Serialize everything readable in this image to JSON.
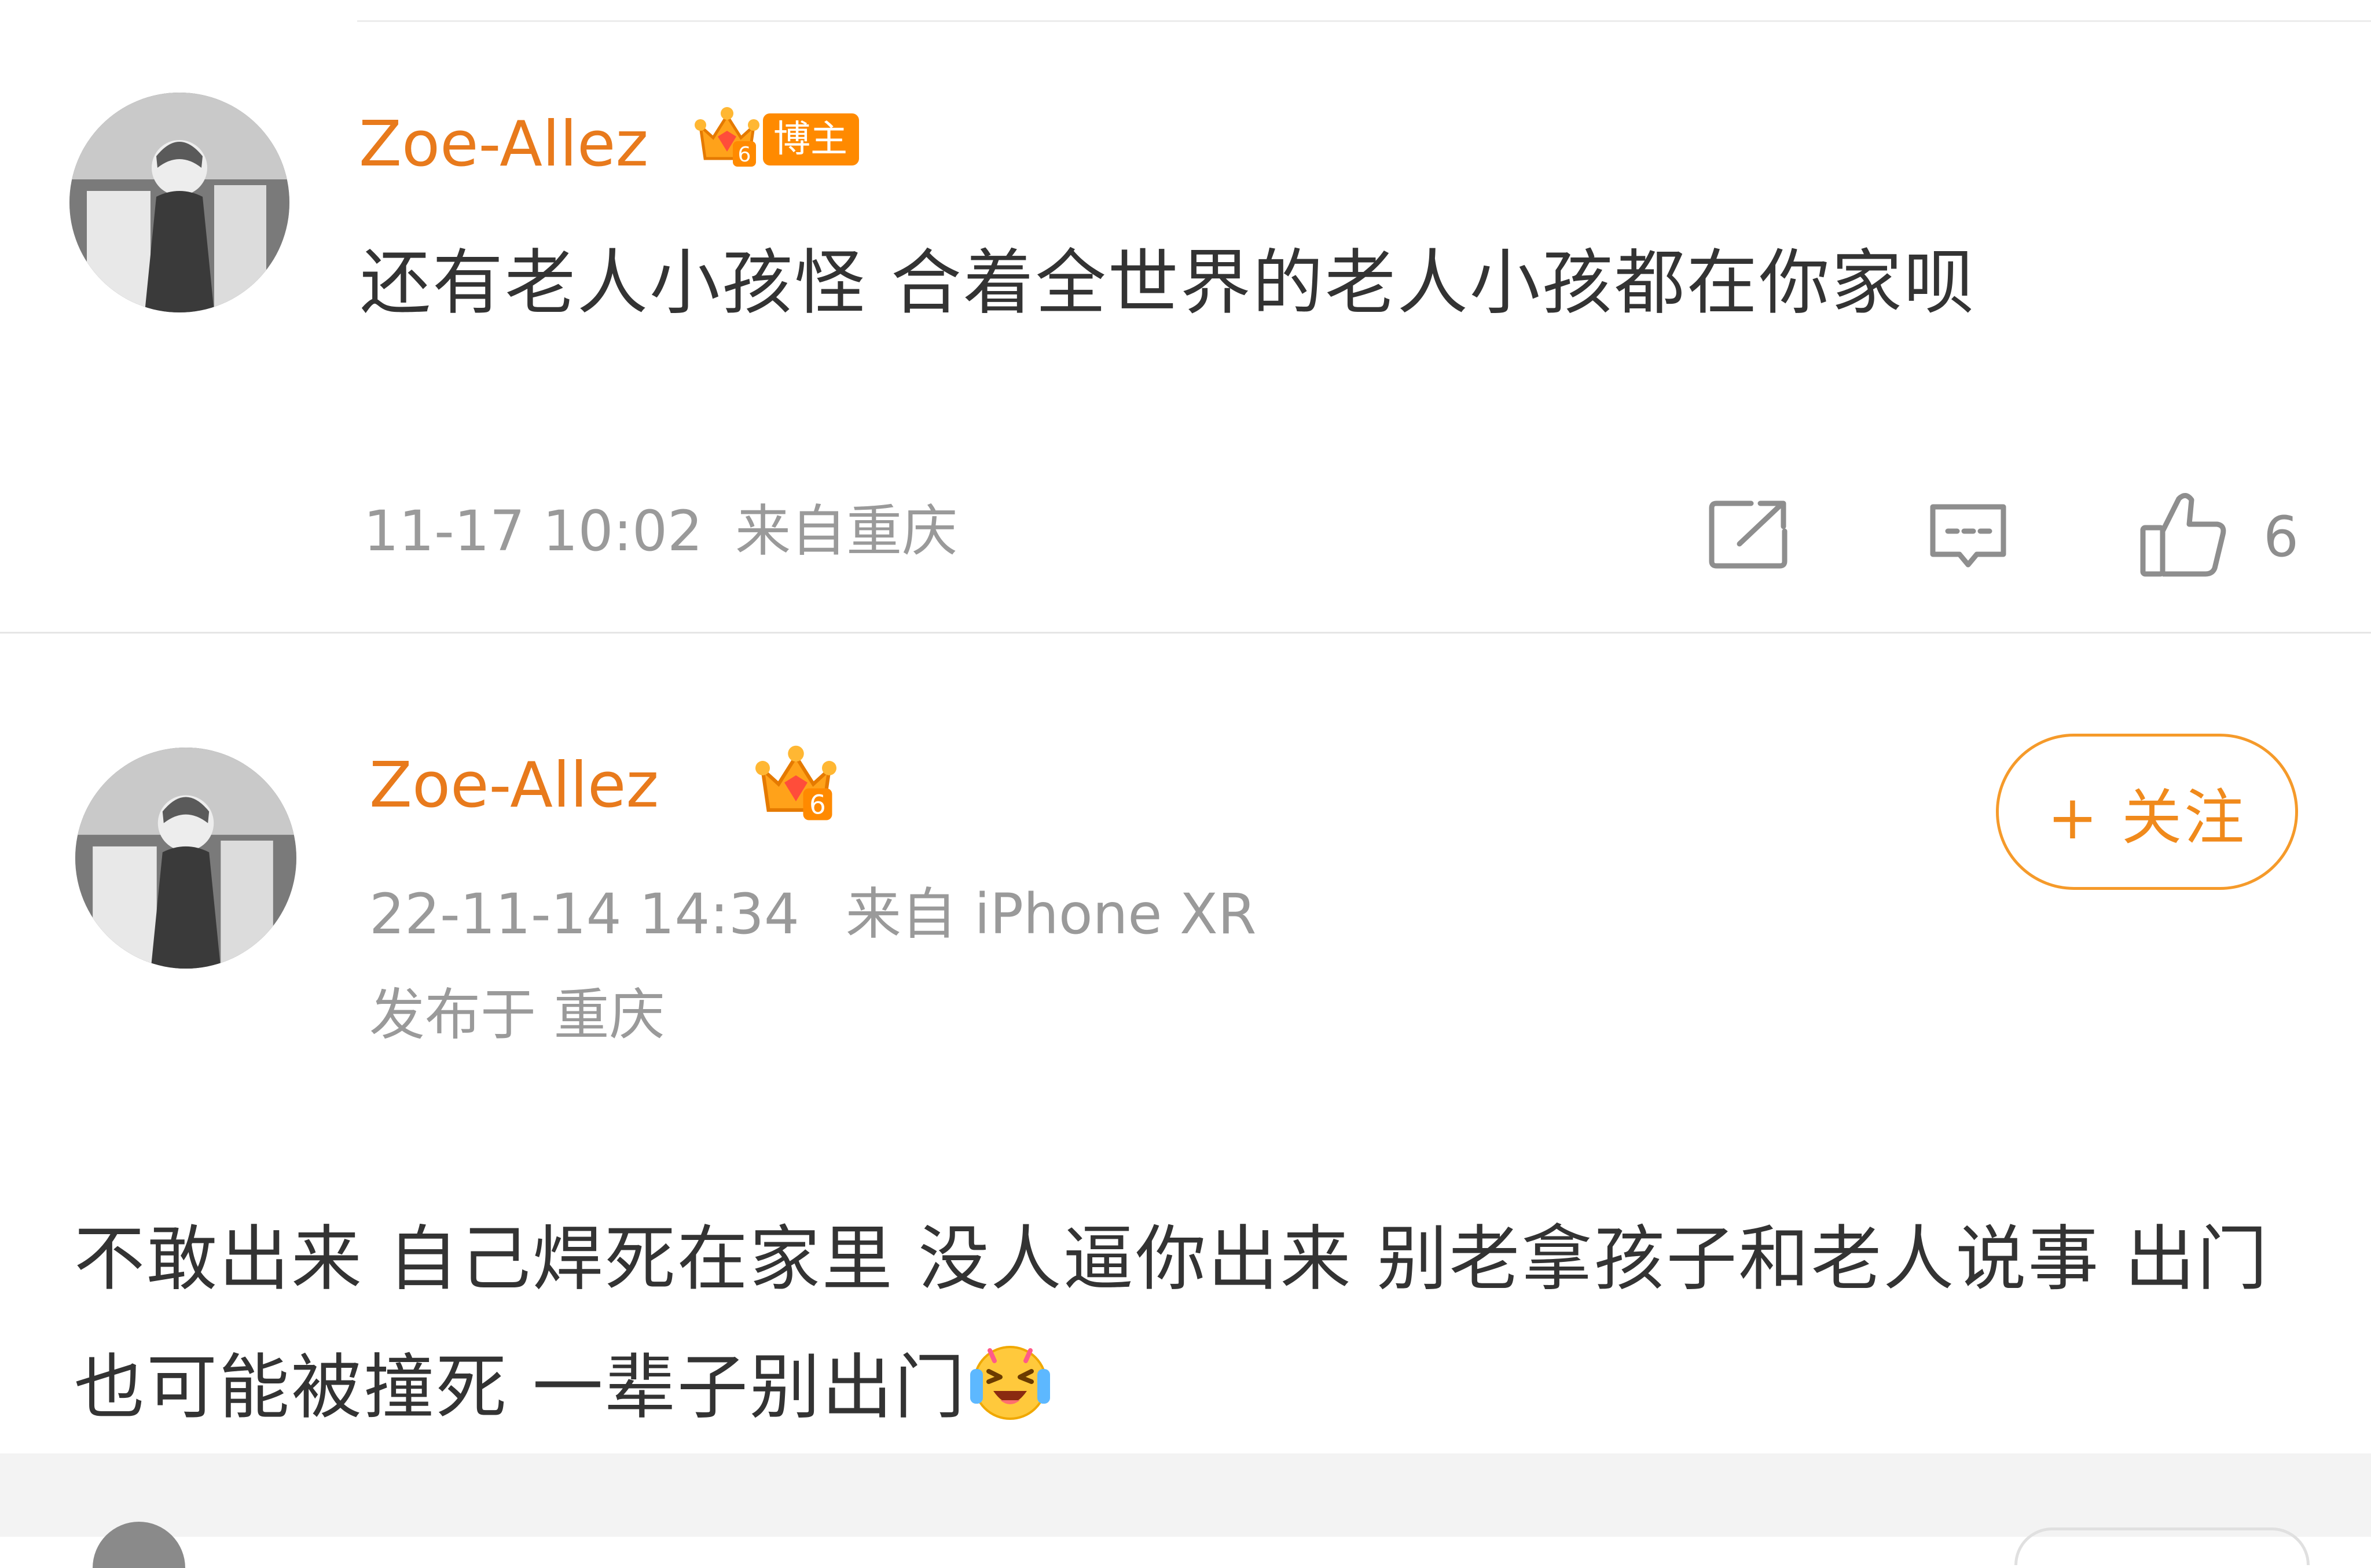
{
  "comment": {
    "username": "Zoe-Allez",
    "badge_label": "博主",
    "level": "6",
    "text": "还有老人小孩怪 合着全世界的老人小孩都在你家呗",
    "time": "11-17 10:02",
    "location": "来自重庆",
    "like_count": "6",
    "icons": {
      "share": "share-icon",
      "comment": "comment-icon",
      "like": "thumbs-up-icon"
    }
  },
  "post": {
    "username": "Zoe-Allez",
    "level": "6",
    "follow_label": "+ 关注",
    "time": "22-11-14 14:34",
    "device": "来自 iPhone XR",
    "location": "发布于 重庆",
    "text": "不敢出来 自己焊死在家里 没人逼你出来 别老拿孩子和老人说事 出门也可能被撞死 一辈子别出门",
    "emoji": "laughing-crying-emoji"
  },
  "colors": {
    "username": "#e87a1c",
    "follow_border": "#f59a2a",
    "badge": "#ff8a00",
    "muted_text": "#9a9a9a",
    "body_text": "#333333"
  }
}
